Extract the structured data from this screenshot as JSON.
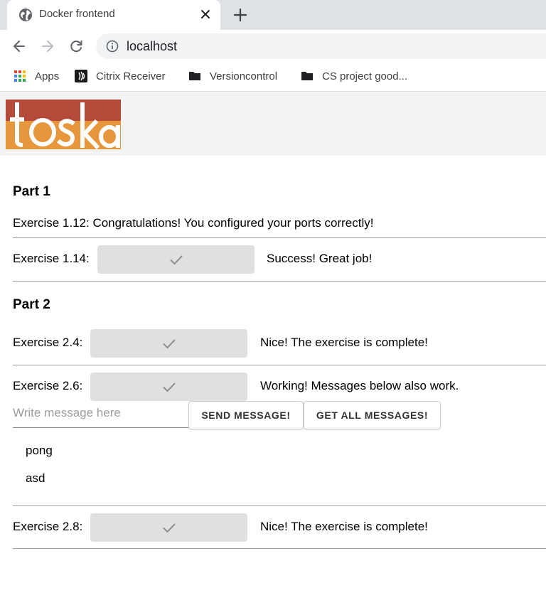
{
  "browser": {
    "tab_title": "Docker frontend",
    "url": "localhost",
    "bookmarks": [
      {
        "label": "Apps",
        "icon": "apps-grid-icon"
      },
      {
        "label": "Citrix Receiver",
        "icon": "citrix-icon"
      },
      {
        "label": "Versioncontrol",
        "icon": "folder-icon"
      },
      {
        "label": "CS project good...",
        "icon": "folder-icon"
      }
    ]
  },
  "logo": {
    "text": "toska",
    "colors": {
      "top": "#b5493a",
      "bottom": "#e8963b"
    }
  },
  "part1": {
    "title": "Part 1",
    "ex112_text": "Exercise 1.12: Congratulations! You configured your ports correctly!",
    "ex114_label": "Exercise 1.14:",
    "ex114_status": "Success! Great job!"
  },
  "part2": {
    "title": "Part 2",
    "ex24_label": "Exercise 2.4:",
    "ex24_status": "Nice! The exercise is complete!",
    "ex26_label": "Exercise 2.6:",
    "ex26_status": "Working! Messages below also work.",
    "message_input_placeholder": "Write message here",
    "send_button": "SEND MESSAGE!",
    "get_button": "GET ALL MESSAGES!",
    "messages": [
      "pong",
      "asd"
    ],
    "ex28_label": "Exercise 2.8:",
    "ex28_status": "Nice! The exercise is complete!"
  }
}
